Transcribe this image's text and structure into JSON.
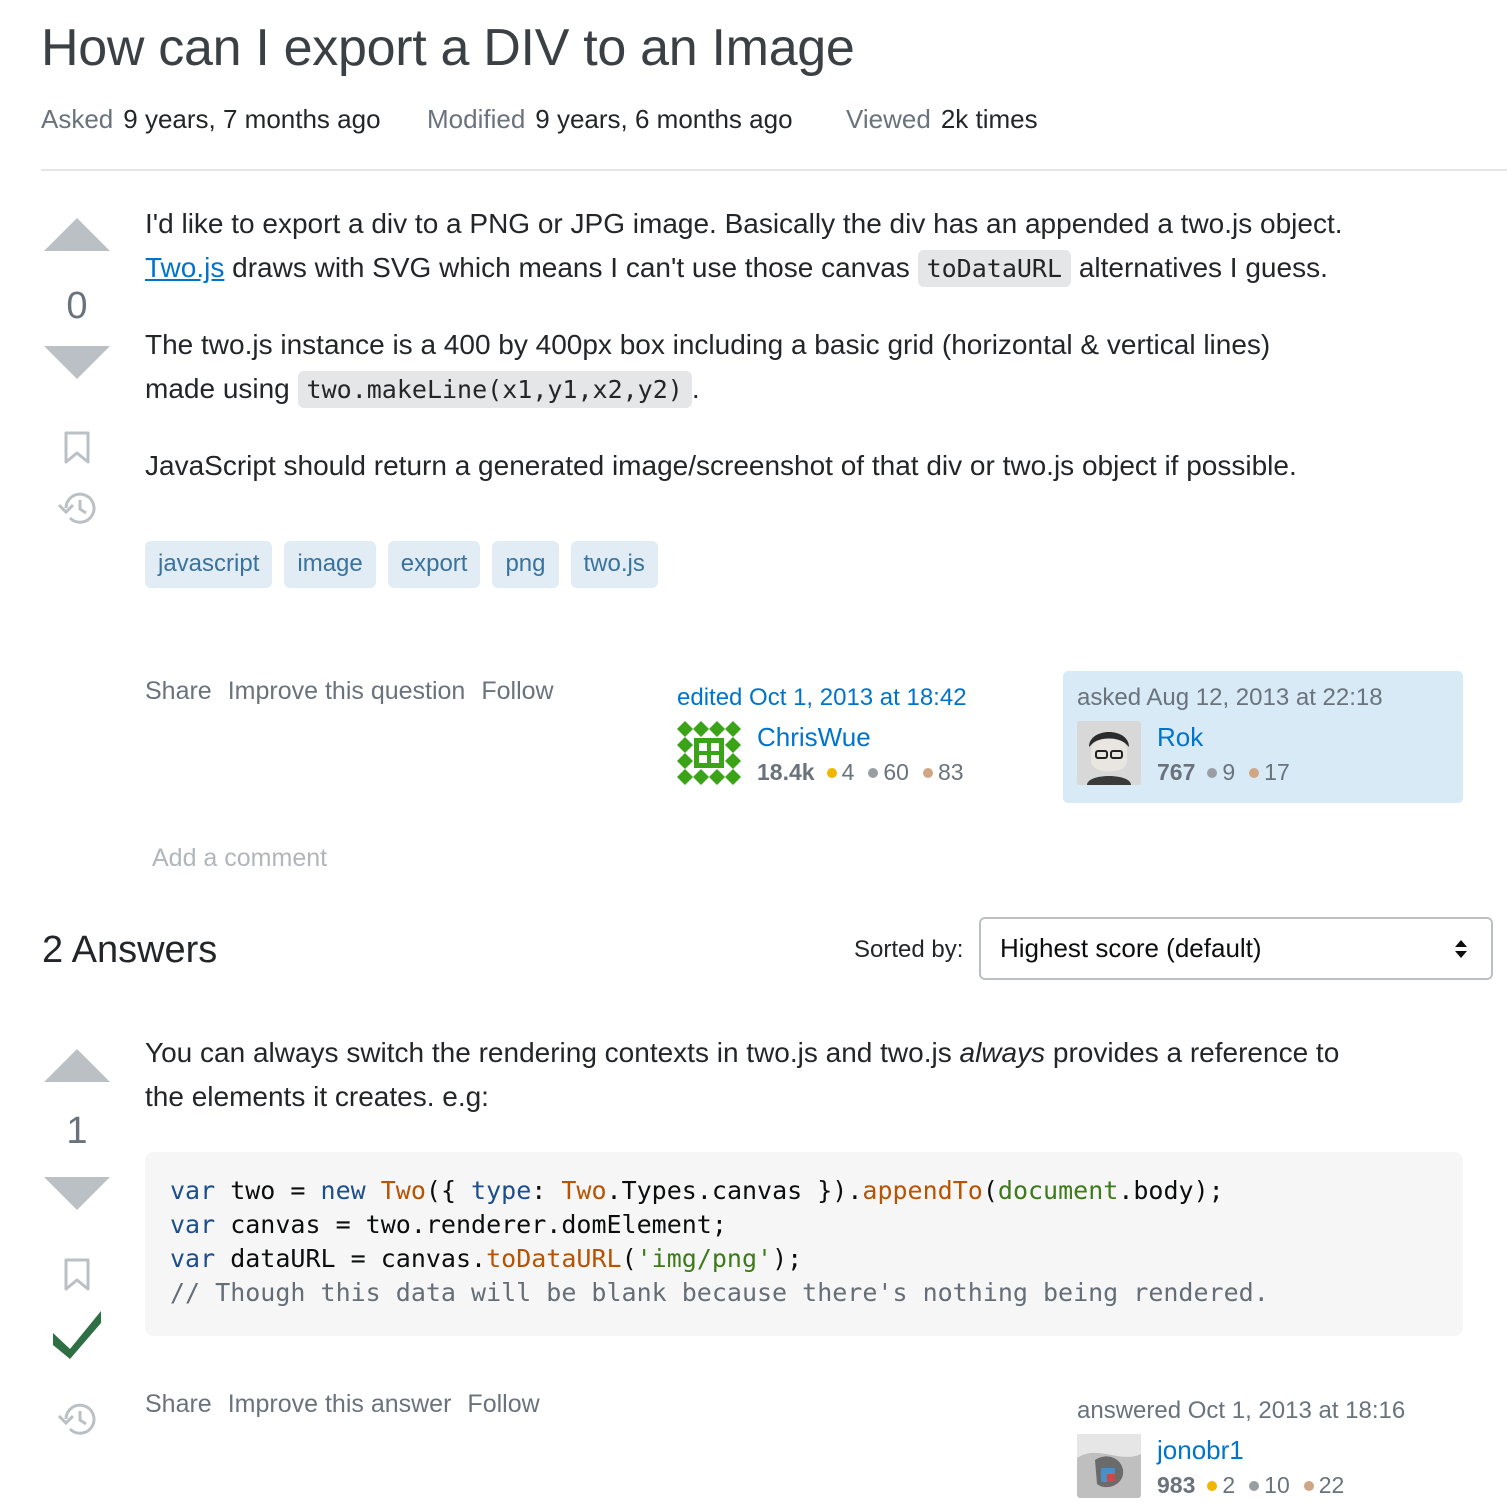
{
  "question": {
    "title": "How can I export a DIV to an Image",
    "meta": [
      {
        "label": "Asked",
        "value": "9 years, 7 months ago"
      },
      {
        "label": "Modified",
        "value": "9 years, 6 months ago"
      },
      {
        "label": "Viewed",
        "value": "2k times"
      }
    ],
    "score": "0",
    "body": {
      "p1_a": "I'd like to export a div to a PNG or JPG image. Basically the div has an appended a two.js object.",
      "p1_link": "Two.js",
      "p1_b": " draws with SVG which means I can't use those canvas ",
      "p1_code": "toDataURL",
      "p1_c": " alternatives I guess.",
      "p2_a": "The two.js instance is a 400 by 400px box including a basic grid (horizontal & vertical lines)",
      "p2_b": "made using ",
      "p2_code": "two.makeLine(x1,y1,x2,y2)",
      "p2_c": ".",
      "p3": "JavaScript should return a generated image/screenshot of that div or two.js object if possible."
    },
    "tags": [
      "javascript",
      "image",
      "export",
      "png",
      "two.js"
    ],
    "menu": {
      "share": "Share",
      "improve": "Improve this question",
      "follow": "Follow"
    },
    "editor": {
      "time": "edited Oct 1, 2013 at 18:42",
      "name": "ChrisWue",
      "rep": "18.4k",
      "gold": "4",
      "silver": "60",
      "bronze": "83"
    },
    "owner": {
      "time": "asked Aug 12, 2013 at 22:18",
      "name": "Rok",
      "rep": "767",
      "silver": "9",
      "bronze": "17"
    },
    "add_comment": "Add a comment"
  },
  "answers_header": {
    "count": "2 Answers",
    "sorted_label": "Sorted by:",
    "sort_value": "Highest score (default)"
  },
  "answer": {
    "score": "1",
    "body_a": "You can always switch the rendering contexts in two.js and two.js ",
    "body_em": "always",
    "body_b": " provides a reference to",
    "body_c": "the elements it creates. e.g:",
    "code": {
      "l1": [
        "var",
        " two = ",
        "new",
        " ",
        "Two",
        "({ ",
        "type",
        ": ",
        "Two",
        ".Types.canvas }).",
        "appendTo",
        "(",
        "document",
        ".body);"
      ],
      "l2": [
        "var",
        " canvas = two.renderer.domElement;"
      ],
      "l3": [
        "var",
        " dataURL = canvas.",
        "toDataURL",
        "(",
        "'img/png'",
        ");"
      ],
      "l4": "// Though this data will be blank because there's nothing being rendered."
    },
    "menu": {
      "share": "Share",
      "improve": "Improve this answer",
      "follow": "Follow"
    },
    "author": {
      "time": "answered Oct 1, 2013 at 18:16",
      "name": "jonobr1",
      "rep": "983",
      "gold": "2",
      "silver": "10",
      "bronze": "22"
    }
  },
  "colors": {
    "link": "#0074cc",
    "tag_bg": "#e1ecf4",
    "tag_fg": "#39739d",
    "accepted": "#2f6f44",
    "owner_bg": "#d9eaf7"
  }
}
